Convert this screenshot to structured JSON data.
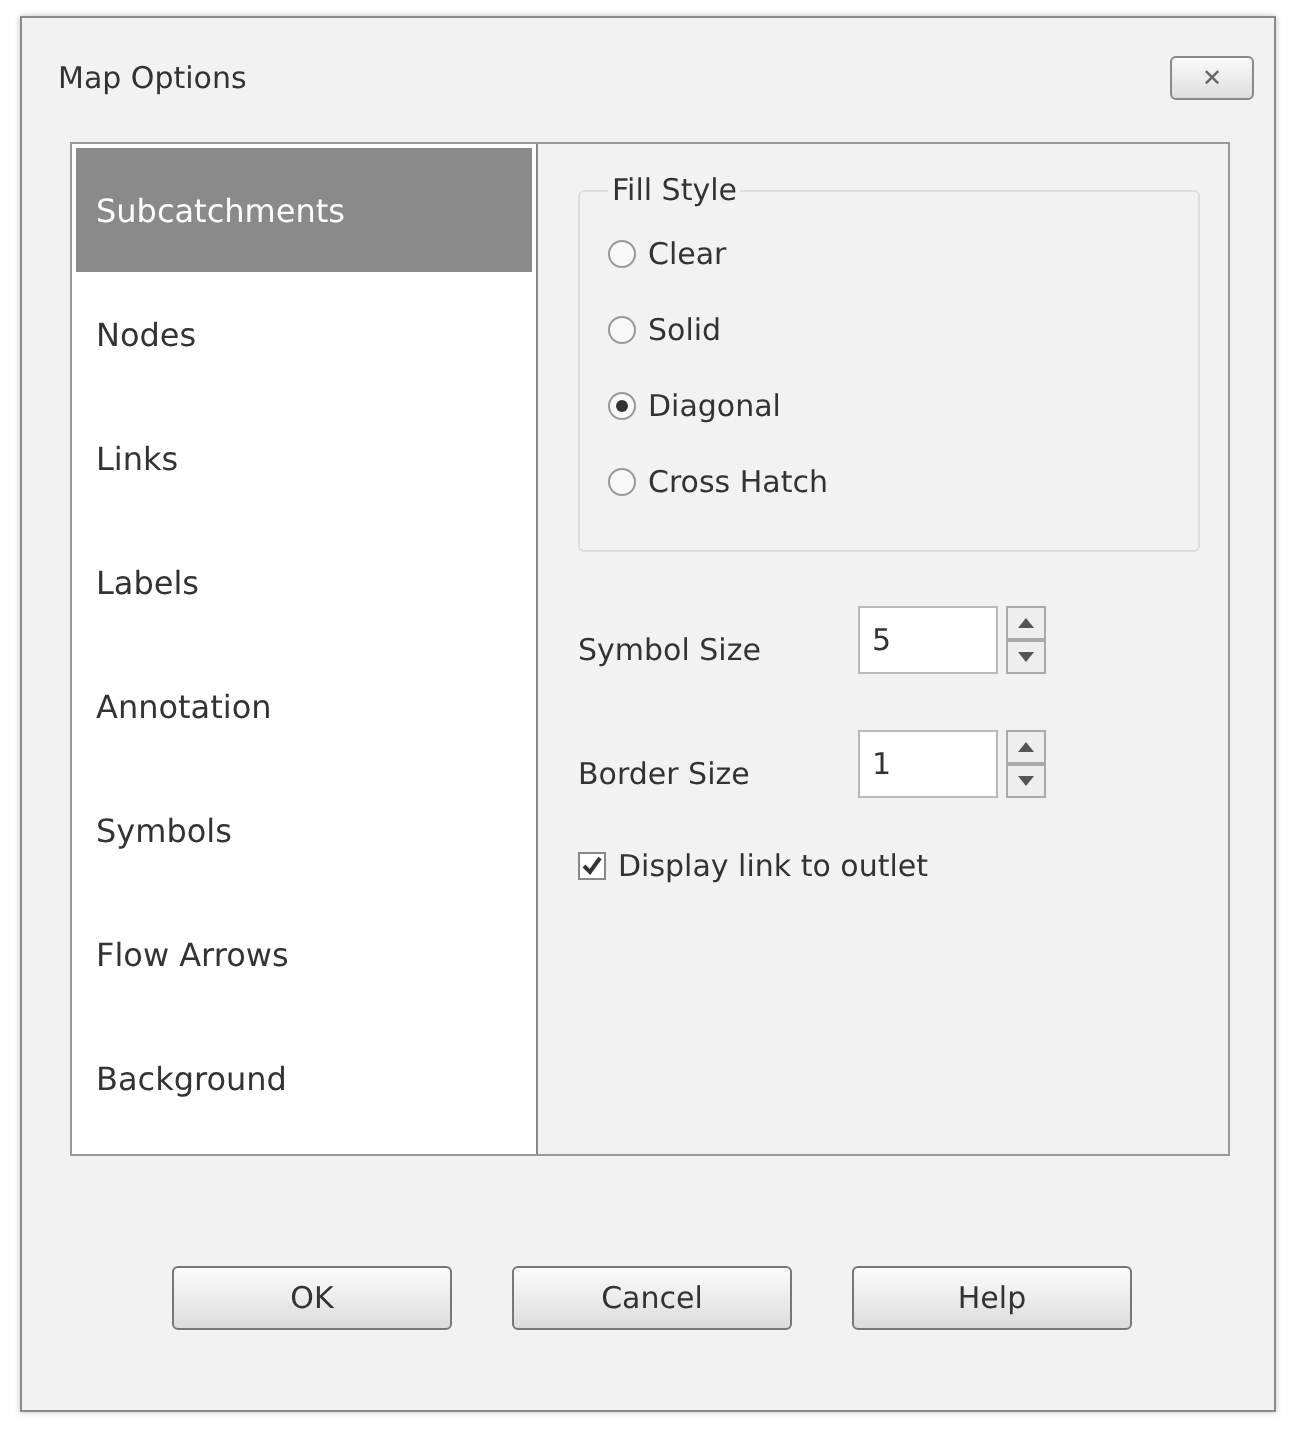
{
  "window": {
    "title": "Map Options",
    "close": "✕"
  },
  "sidebar": {
    "items": [
      {
        "label": "Subcatchments",
        "selected": true
      },
      {
        "label": "Nodes",
        "selected": false
      },
      {
        "label": "Links",
        "selected": false
      },
      {
        "label": "Labels",
        "selected": false
      },
      {
        "label": "Annotation",
        "selected": false
      },
      {
        "label": "Symbols",
        "selected": false
      },
      {
        "label": "Flow Arrows",
        "selected": false
      },
      {
        "label": "Background",
        "selected": false
      }
    ]
  },
  "fill_style": {
    "title": "Fill Style",
    "options": [
      {
        "label": "Clear",
        "selected": false
      },
      {
        "label": "Solid",
        "selected": false
      },
      {
        "label": "Diagonal",
        "selected": true
      },
      {
        "label": "Cross Hatch",
        "selected": false
      }
    ]
  },
  "spinners": [
    {
      "label": "Symbol Size",
      "value": "5"
    },
    {
      "label": "Border Size",
      "value": "1"
    }
  ],
  "checkbox": {
    "label": "Display link to outlet",
    "checked": true
  },
  "buttons": [
    "OK",
    "Cancel",
    "Help"
  ]
}
